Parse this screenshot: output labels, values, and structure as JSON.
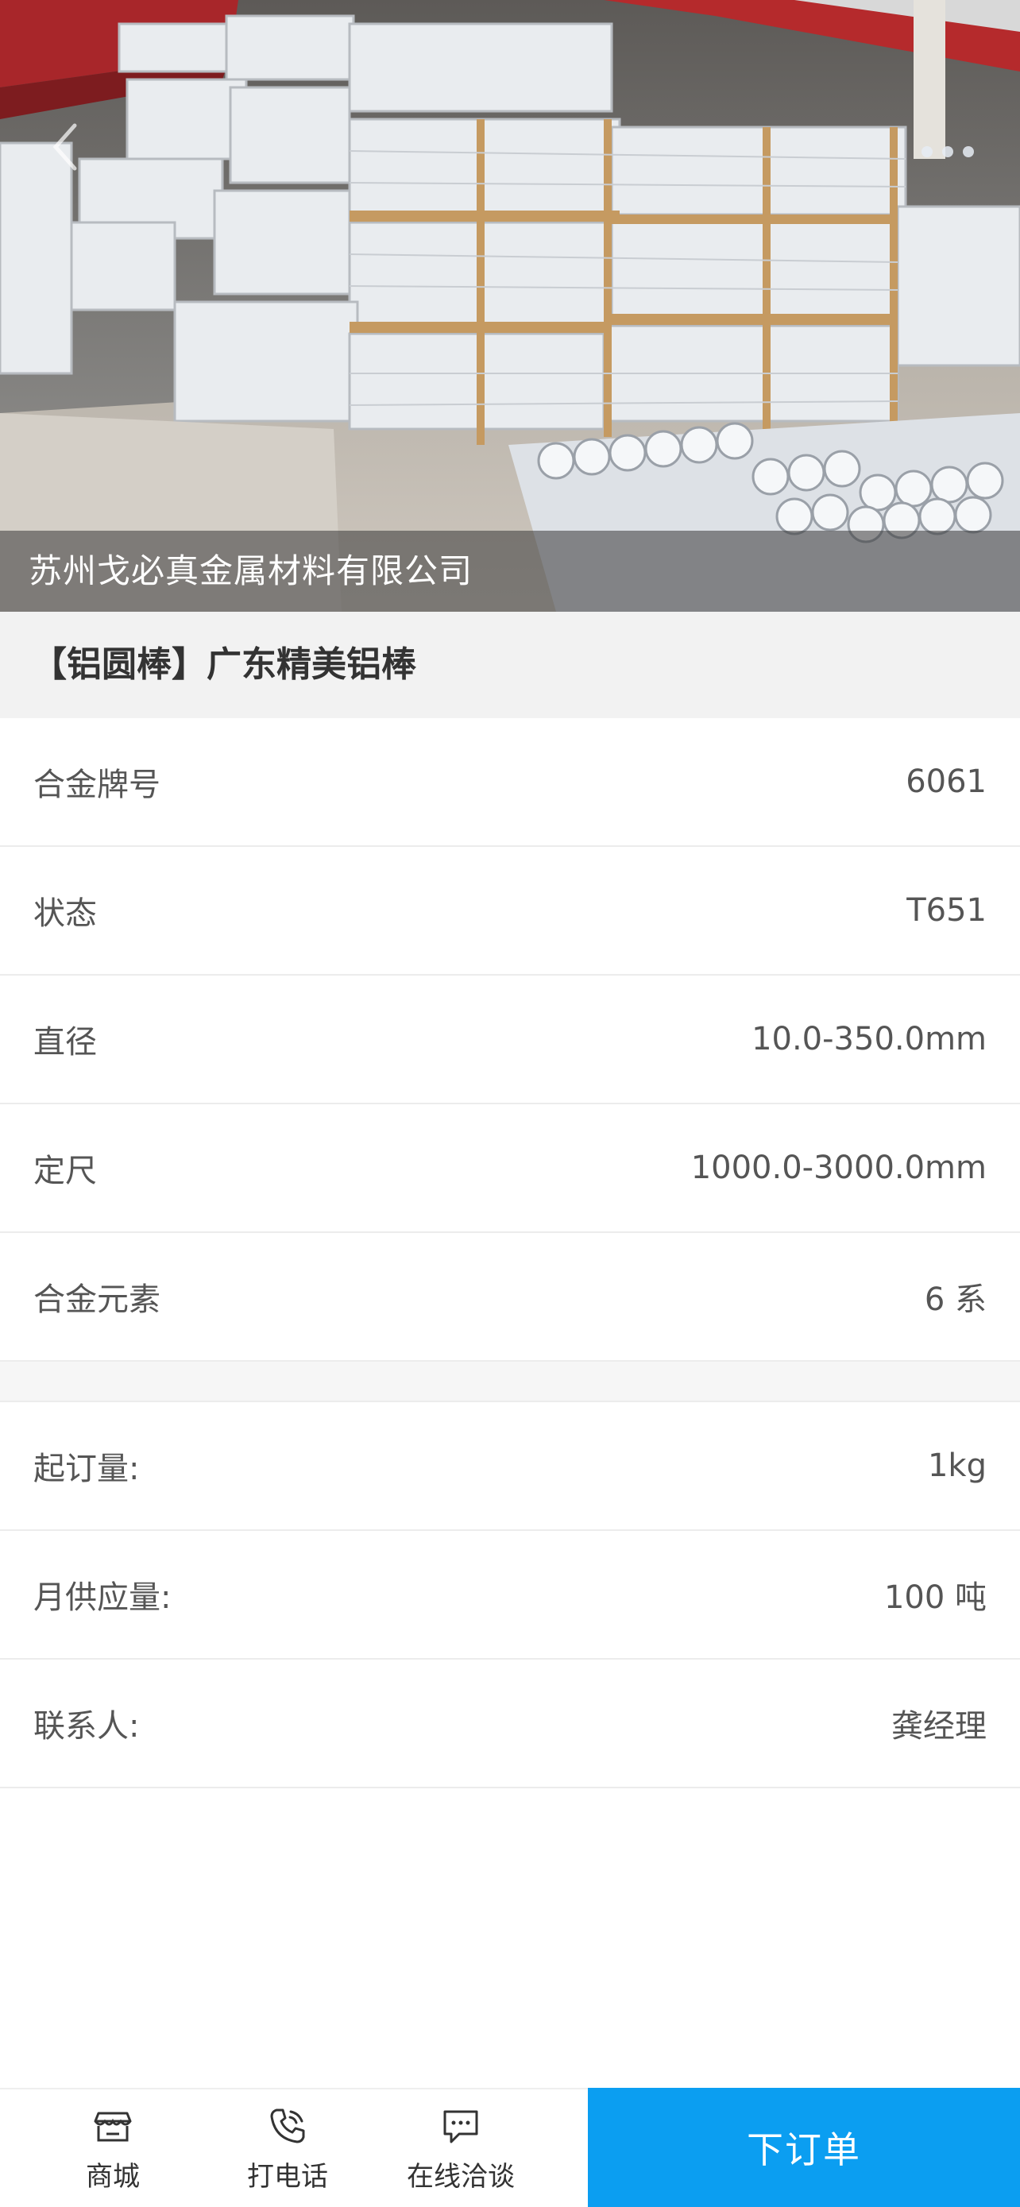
{
  "hero": {
    "company": "苏州戈必真金属材料有限公司",
    "slides": 3
  },
  "product": {
    "title": "【铝圆棒】广东精美铝棒"
  },
  "specs": [
    {
      "label": "合金牌号",
      "value": "6061"
    },
    {
      "label": "状态",
      "value": "T651"
    },
    {
      "label": "直径",
      "value": "10.0-350.0mm"
    },
    {
      "label": "定尺",
      "value": "1000.0-3000.0mm"
    },
    {
      "label": "合金元素",
      "value": "6 系"
    }
  ],
  "info": [
    {
      "label": "起订量:",
      "value": "1kg"
    },
    {
      "label": "月供应量:",
      "value": "100 吨"
    },
    {
      "label": "联系人:",
      "value": "龚经理"
    }
  ],
  "bottom_bar": {
    "shop": {
      "label": "商城",
      "icon": "store-icon"
    },
    "call": {
      "label": "打电话",
      "icon": "phone-icon"
    },
    "chat": {
      "label": "在线洽谈",
      "icon": "chat-icon"
    },
    "order_label": "下订单",
    "accent": "#0b9ef1"
  }
}
